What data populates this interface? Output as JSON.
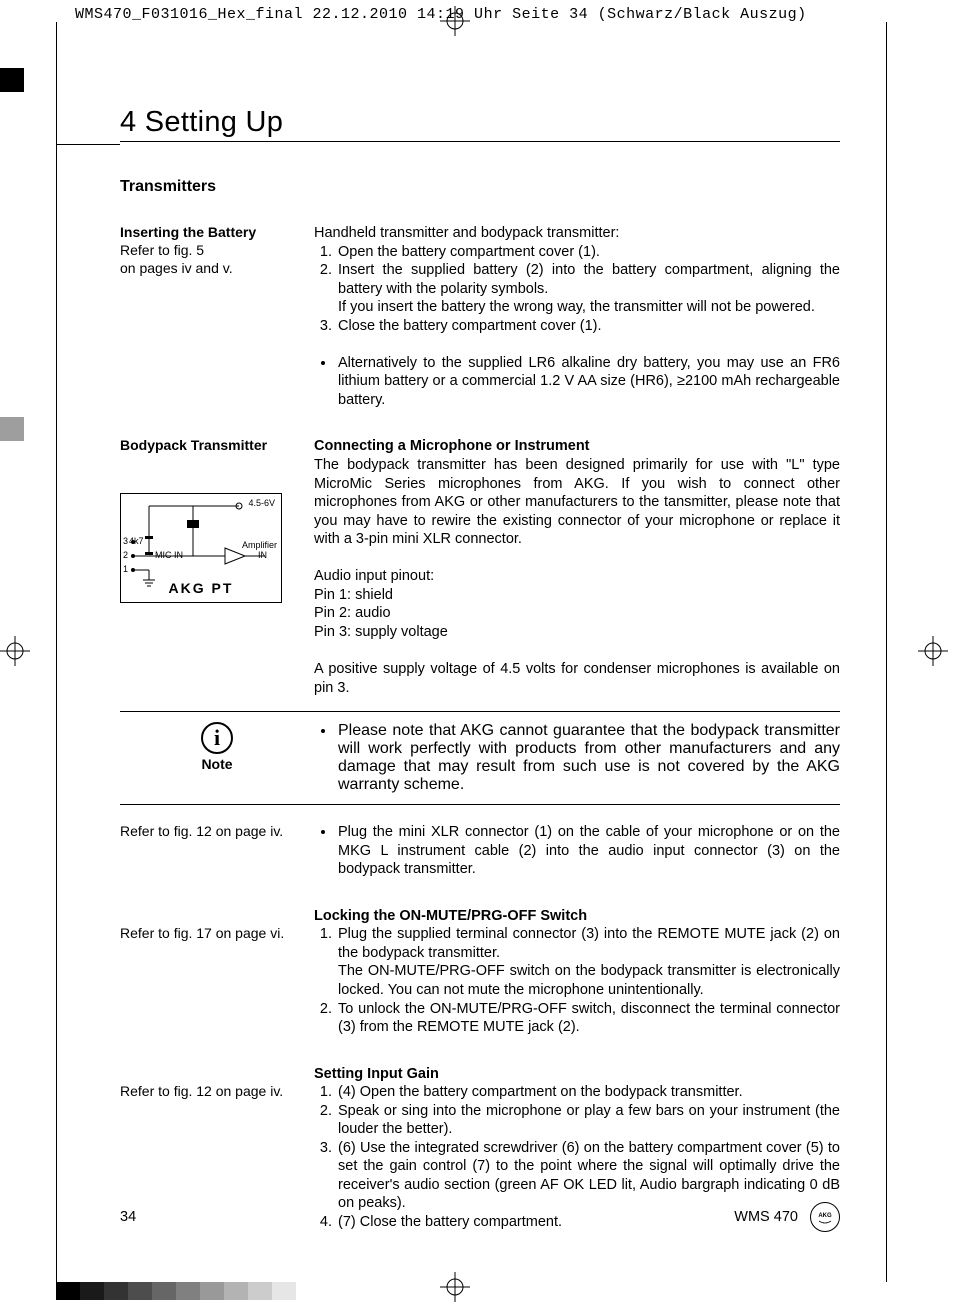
{
  "print_header": "WMS470_F031016_Hex_final  22.12.2010  14:19 Uhr  Seite 34    (Schwarz/Black Auszug)",
  "chapter": "4 Setting Up",
  "section": "Transmitters",
  "battery": {
    "margin_title": "Inserting the Battery",
    "margin_ref1": "Refer to fig. 5",
    "margin_ref2": "on pages iv and v.",
    "intro": "Handheld transmitter and bodypack transmitter:",
    "step1": "Open the battery compartment cover (1).",
    "step2": "Insert the supplied battery (2) into the battery compartment, aligning the battery with the polarity symbols.",
    "step2b": "If you insert the battery the wrong way, the transmitter will not be powered.",
    "step3": "Close the battery compartment cover (1).",
    "alt": "Alternatively to the supplied LR6 alkaline dry battery, you may use an FR6 lithium battery or a commercial 1.2 V AA size (HR6), ≥2100 mAh rechargeable battery."
  },
  "bodypack": {
    "margin_title": "Bodypack Transmitter",
    "sub_h": "Connecting a Microphone or Instrument",
    "p1": "The bodypack transmitter has been designed primarily for use with \"L\" type MicroMic Series microphones from AKG. If you wish to connect other microphones from AKG or other manufacturers to the tansmitter, please note that you may have to rewire the existing connector of your microphone or replace it with a 3-pin mini XLR connector.",
    "pinout_h": "Audio input pinout:",
    "pin1": "Pin 1: shield",
    "pin2": "Pin 2: audio",
    "pin3": "Pin 3: supply voltage",
    "p2": "A positive supply voltage of 4.5 volts for condenser microphones is available on pin 3."
  },
  "diagram": {
    "v": "4.5-6V",
    "r": "4k7",
    "p3": "3",
    "p2": "2",
    "p1": "1",
    "mic": "MIC IN",
    "amp1": "Amplifier",
    "amp2": "IN",
    "brand": "AKG PT"
  },
  "note": {
    "label": "Note",
    "text": "Please note that AKG cannot guarantee that the bodypack transmitter will work perfectly with products from other manufacturers and any damage that may result from such use is not covered by the AKG warranty scheme."
  },
  "plug": {
    "margin": "Refer to fig. 12 on page iv.",
    "text": "Plug the mini XLR connector (1) on the cable of your microphone or on the MKG L instrument cable (2) into the audio input connector (3) on the bodypack transmitter."
  },
  "lock": {
    "margin": "Refer to fig. 17 on page vi.",
    "sub_h": "Locking the ON-MUTE/PRG-OFF Switch",
    "s1": "Plug the supplied terminal connector (3) into the REMOTE MUTE jack (2) on the bodypack transmitter.",
    "s1b": "The ON-MUTE/PRG-OFF switch on the bodypack transmitter is electronically locked. You can not mute the microphone unintentionally.",
    "s2": "To unlock the ON-MUTE/PRG-OFF switch, disconnect the terminal connector (3) from the REMOTE MUTE jack (2)."
  },
  "gain": {
    "margin": "Refer to fig. 12 on page iv.",
    "sub_h": "Setting Input Gain",
    "s1": "(4) Open the battery compartment on the bodypack transmitter.",
    "s2": "Speak or sing into the microphone or play a few bars on your instrument (the louder the better).",
    "s3": "(6) Use the integrated screwdriver (6) on the battery compartment cover (5) to set the gain control (7) to the point where the signal will optimally drive the receiver's audio section (green AF OK LED lit, Audio bargraph indicating 0 dB on peaks).",
    "s4": "(7) Close the battery compartment."
  },
  "footer": {
    "page": "34",
    "model": "WMS 470"
  }
}
